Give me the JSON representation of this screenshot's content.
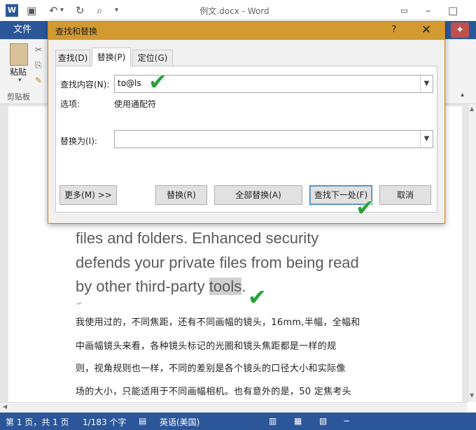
{
  "window": {
    "title": "例文.docx - Word",
    "file_tab": "文件"
  },
  "ribbon": {
    "paste_label": "粘贴",
    "clipboard_group": "剪贴板"
  },
  "document": {
    "en_lines": [
      "files and folders. Enhanced security",
      "defends your private files from being read",
      "by other third-party "
    ],
    "en_highlight": "tools",
    "en_tail": ".",
    "zh_lines": [
      "我使用过的，不同焦距，还有不同画幅的镜头，16mm,半幅，全幅和",
      "中画幅镜头来看，各种镜头标记的光圈和镜头焦距都是一样的规",
      "则，视角规则也一样，不同的差别是各个镜头的口径大小和实际像",
      "场的大小，只能适用于不同画幅相机。也有意外的是，50 定焦考头"
    ]
  },
  "dialog": {
    "title": "查找和替换",
    "help": "?",
    "close": "✕",
    "tabs": {
      "find": "查找(D)",
      "replace": "替换(P)",
      "goto": "定位(G)"
    },
    "find_label": "查找内容(N):",
    "find_value": "to@ls",
    "options_label": "选项:",
    "options_value": "使用通配符",
    "replace_label": "替换为(I):",
    "replace_value": "",
    "buttons": {
      "more": "更多(M) >>",
      "replace": "替换(R)",
      "replace_all": "全部替换(A)",
      "find_next": "查找下一处(F)",
      "cancel": "取消"
    }
  },
  "status": {
    "page": "第 1 页，共 1 页",
    "words": "1/183 个字",
    "language": "英语(美国)"
  },
  "colors": {
    "word_blue": "#2b579a",
    "dialog_title": "#d29a31",
    "check_green": "#2aa13a"
  }
}
